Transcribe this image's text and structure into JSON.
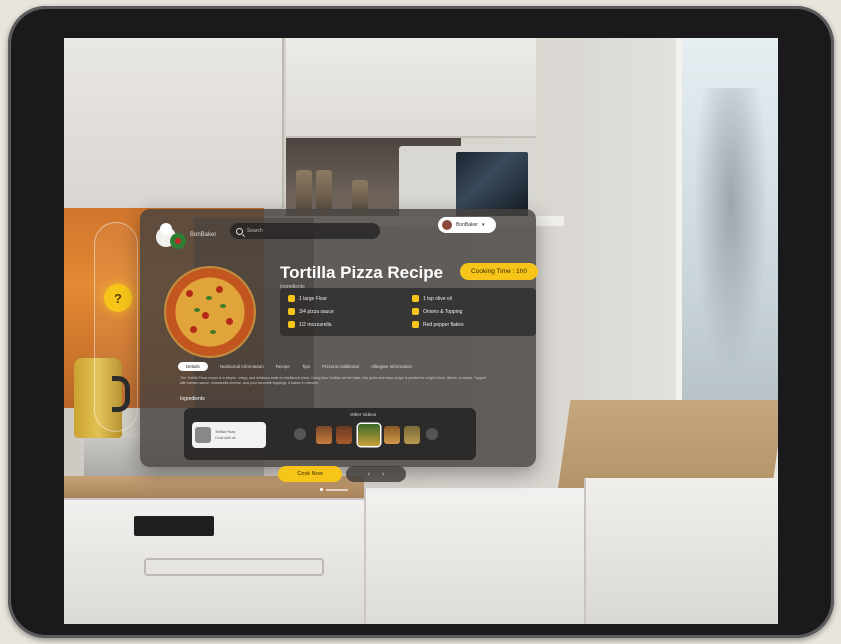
{
  "header": {
    "brand": "BonBaker",
    "search_placeholder": "Search",
    "user_name": "BonBaker",
    "user_menu": "▾"
  },
  "recipe": {
    "title": "Tortilla Pizza Recipe",
    "subtitle": "Ingredients",
    "cooking_time": "Cooking Time : 1h0",
    "ingredients": [
      "1 large Flour",
      "1 tsp olive oil",
      "3/4 pizza sauce",
      "Onions & Topping",
      "1/2 mozzarella",
      "Red pepper flakes"
    ],
    "tabs": [
      "Details",
      "Nutritional Information",
      "Recipe",
      "Tips",
      "Pizzeria Additional",
      "Allergies Information"
    ],
    "description": "The Tortilla Pizza recipe is a simple, crispy, and delicious twist on traditional pizza. Using flour tortillas as the base, this quick and easy recipe is perfect for a light lunch, dinner, or snack. Topped with tomato sauce, mozzarella cheese, and your favourite toppings, it bakes in minutes.",
    "section_label": "Ingredients"
  },
  "videos": {
    "label": "Other Videos",
    "card_title": "Tortilla Pizza",
    "card_sub": "Cook with us"
  },
  "actions": {
    "cook_now": "Cook Now",
    "prev": "‹",
    "next": "›"
  },
  "colors": {
    "accent": "#f7c51a",
    "panel": "#46423f"
  }
}
